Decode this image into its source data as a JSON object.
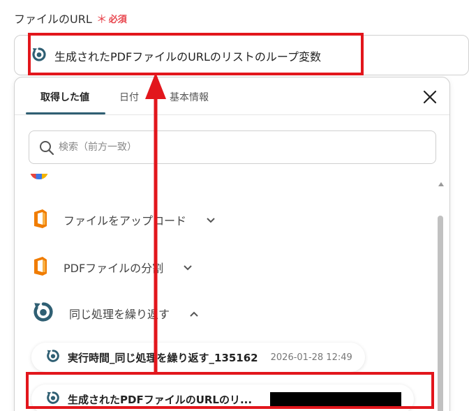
{
  "field": {
    "label": "ファイルのURL",
    "required_mark": "＊",
    "required_text": "必須",
    "value": "生成されたPDFファイルのURLのリストのループ変数"
  },
  "panel": {
    "tabs": [
      {
        "label": "取得した値",
        "active": true
      },
      {
        "label": "日付",
        "active": false
      },
      {
        "label": "基本情報",
        "active": false
      }
    ],
    "search_placeholder": "検索（前方一致）",
    "apps": [
      {
        "label": "ファイルをアップロード",
        "icon": "office-file-icon",
        "expanded": false
      },
      {
        "label": "PDFファイルの分割",
        "icon": "office-file-icon",
        "expanded": false
      },
      {
        "label": "同じ処理を繰り返す",
        "icon": "loop-icon",
        "expanded": true
      }
    ],
    "values": [
      {
        "label": "実行時間_同じ処理を繰り返す_135162",
        "time": "2026-01-28 12:49"
      },
      {
        "label": "生成されたPDFファイルのURLのリ...",
        "time": ""
      }
    ]
  },
  "colors": {
    "accent": "#2f5f73",
    "highlight": "#e2161c",
    "required": "#e8454d",
    "office_orange": "#f07c00"
  }
}
